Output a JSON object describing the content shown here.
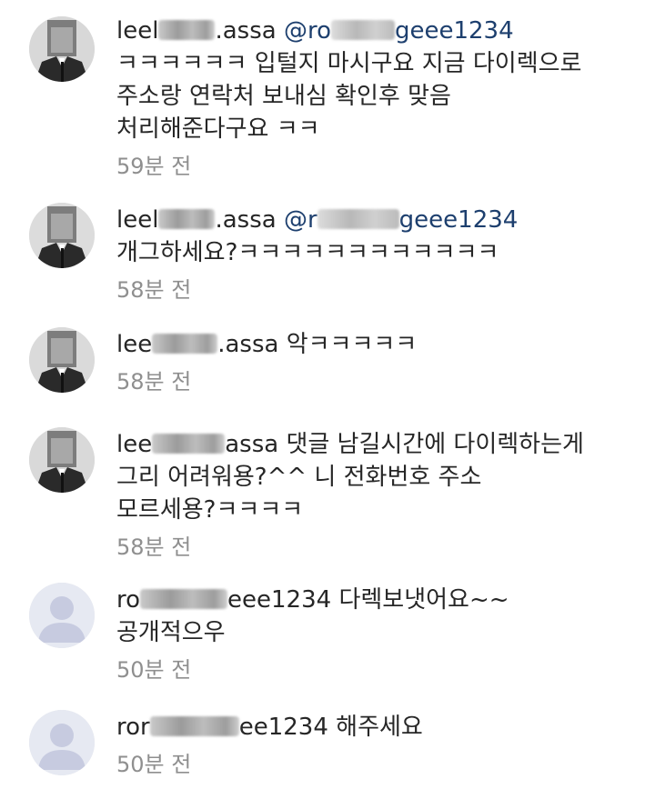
{
  "comments": [
    {
      "username_prefix": "leel",
      "username_suffix": ".assa",
      "mention_prefix": "@ro",
      "mention_suffix": "geee1234",
      "message": "ㅋㅋㅋㅋㅋㅋ 입털지 마시구요 지금 다이렉으로",
      "message_line2": "주소랑 연락처 보내심 확인후 맞음",
      "message_line3": "처리해준다구요 ㅋㅋ",
      "time": "59분 전",
      "avatar_icon": "user-photo-icon"
    },
    {
      "username_prefix": "leel",
      "username_suffix": ".assa",
      "mention_prefix": "@r",
      "mention_suffix": "geee1234",
      "message": "개그하세요?ㅋㅋㅋㅋㅋㅋㅋㅋㅋㅋㅋㅋ",
      "time": "58분 전",
      "avatar_icon": "user-photo-icon"
    },
    {
      "username_prefix": "lee",
      "username_suffix": ".assa",
      "message": "악ㅋㅋㅋㅋㅋ",
      "time": "58분 전",
      "avatar_icon": "user-photo-icon"
    },
    {
      "username_prefix": "lee",
      "username_suffix": "assa",
      "message": "댓글 남길시간에 다이렉하는게",
      "message_line2": "그리 어려워용?^^ 니 전화번호 주소",
      "message_line3": "모르세용?ㅋㅋㅋㅋ",
      "time": "58분 전",
      "avatar_icon": "user-photo-icon"
    },
    {
      "username_prefix": "ro",
      "username_suffix": "eee1234",
      "message": "다렉보냇어요~~",
      "message_line2": "공개적으우",
      "time": "50분 전",
      "avatar_icon": "default-avatar-icon"
    },
    {
      "username_prefix": "ror",
      "username_suffix": "ee1234",
      "message": "해주세요",
      "time": "50분 전",
      "avatar_icon": "default-avatar-icon"
    }
  ],
  "colors": {
    "text": "#262626",
    "mention": "#1d3f6e",
    "time": "#8f8f8f",
    "background": "#ffffff"
  }
}
